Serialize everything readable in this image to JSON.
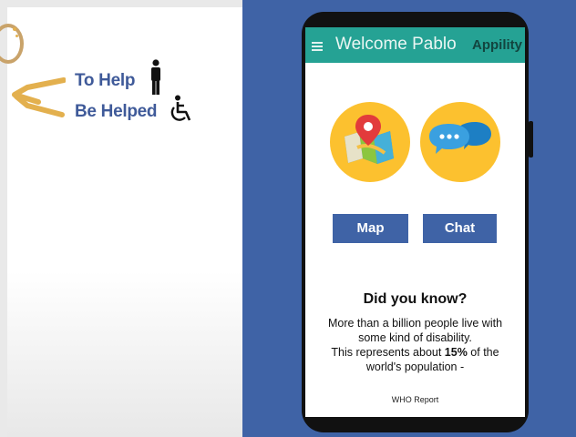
{
  "slide": {
    "to_help": "To Help",
    "be_helped": "Be Helped",
    "accent_blue": "#3f5a99",
    "accent_gold": "#e3b04e"
  },
  "app": {
    "title": "Welcome Pablo",
    "brand": "Appility",
    "header_color": "#25a294",
    "map_label": "Map",
    "chat_label": "Chat",
    "button_color": "#3f63a6",
    "icon_circle_color": "#fcc12f",
    "did_you_know": {
      "title": "Did you know?",
      "line1": "More than a billion people live with some kind of disability.",
      "line2_prefix": "This represents about ",
      "line2_bold": "15%",
      "line2_suffix": " of the world's population -",
      "source": "WHO Report"
    }
  }
}
